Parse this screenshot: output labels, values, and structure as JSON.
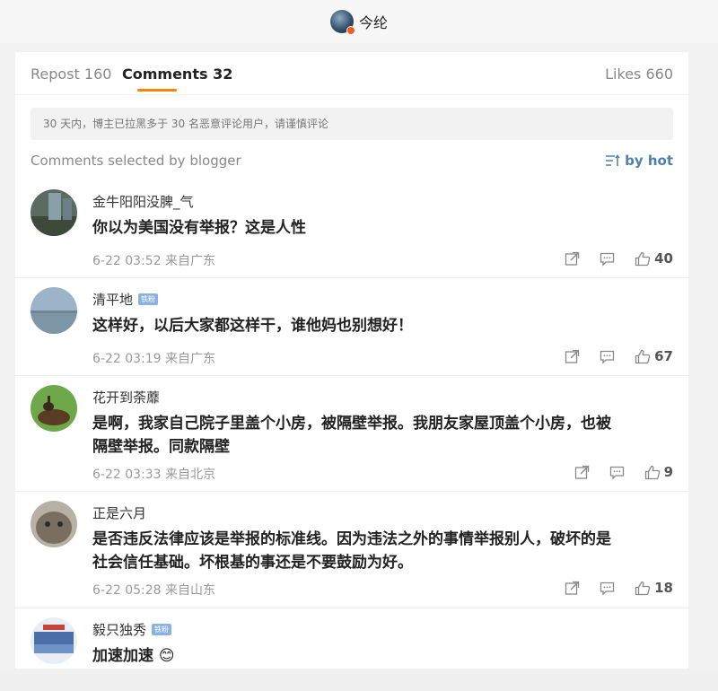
{
  "header": {
    "user_name": "今纶"
  },
  "tabs": {
    "repost": "Repost 160",
    "comments": "Comments 32",
    "likes": "Likes 660"
  },
  "notice": "30 天内，博主已拉黑多于 30 名恶意评论用户，请谨慎评论",
  "section": {
    "title": "Comments selected by blogger",
    "sort_label": "by hot"
  },
  "fan_badge": "铁粉",
  "comments": [
    {
      "user": "金牛阳阳没脾_气",
      "text": "你以为美国没有举报？这是人性",
      "time": "6-22 03:52 来自广东",
      "likes": "40"
    },
    {
      "user": "清平地",
      "text": "这样好，以后大家都这样干，谁他妈也别想好！",
      "time": "6-22 03:19 来自广东",
      "likes": "67"
    },
    {
      "user": "花开到荼蘼",
      "text_line1": "是啊，我家自己院子里盖个小房，被隔壁举报。我朋友家屋顶盖个小房，也被",
      "text_line2": "隔壁举报。同款隔壁",
      "time": "6-22 03:33 来自北京",
      "likes": "9"
    },
    {
      "user": "正是六月",
      "text_line1": "是否违反法律应该是举报的标准线。因为违法之外的事情举报别人，破坏的是",
      "text_line2": "社会信任基础。坏根基的事还是不要鼓励为好。",
      "time": "6-22 05:28 来自山东",
      "likes": "18"
    },
    {
      "user": "毅只独秀",
      "text": "加速加速",
      "emoji": "😊"
    }
  ]
}
